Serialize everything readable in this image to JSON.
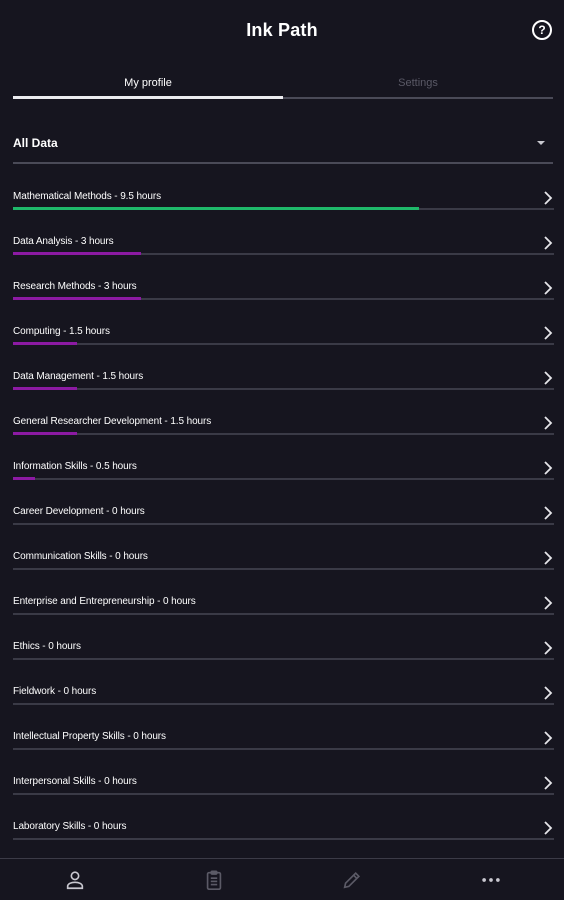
{
  "header": {
    "title": "Ink Path",
    "help_icon": "help-circle-icon"
  },
  "tabs": [
    {
      "label": "My profile",
      "active": true
    },
    {
      "label": "Settings",
      "active": false
    }
  ],
  "filter": {
    "value": "All Data"
  },
  "colors": {
    "background": "#16151f",
    "top_bar": "#1fb86a",
    "bar": "#8c1aa3",
    "track": "#3a3a46"
  },
  "skills": [
    {
      "label": "Mathematical Methods - 9.5 hours",
      "progress": 0.75,
      "color": "#1fb86a"
    },
    {
      "label": "Data Analysis - 3 hours",
      "progress": 0.237,
      "color": "#8c1aa3"
    },
    {
      "label": "Research Methods - 3 hours",
      "progress": 0.237,
      "color": "#8c1aa3"
    },
    {
      "label": "Computing - 1.5 hours",
      "progress": 0.118,
      "color": "#8c1aa3"
    },
    {
      "label": "Data Management - 1.5 hours",
      "progress": 0.118,
      "color": "#8c1aa3"
    },
    {
      "label": "General Researcher Development - 1.5 hours",
      "progress": 0.118,
      "color": "#8c1aa3"
    },
    {
      "label": "Information Skills - 0.5 hours",
      "progress": 0.04,
      "color": "#8c1aa3"
    },
    {
      "label": "Career Development - 0 hours",
      "progress": 0,
      "color": "#8c1aa3"
    },
    {
      "label": "Communication Skills - 0 hours",
      "progress": 0,
      "color": "#8c1aa3"
    },
    {
      "label": "Enterprise and Entrepreneurship - 0 hours",
      "progress": 0,
      "color": "#8c1aa3"
    },
    {
      "label": "Ethics - 0 hours",
      "progress": 0,
      "color": "#8c1aa3"
    },
    {
      "label": "Fieldwork - 0 hours",
      "progress": 0,
      "color": "#8c1aa3"
    },
    {
      "label": "Intellectual Property Skills - 0 hours",
      "progress": 0,
      "color": "#8c1aa3"
    },
    {
      "label": "Interpersonal Skills - 0 hours",
      "progress": 0,
      "color": "#8c1aa3"
    },
    {
      "label": "Laboratory Skills - 0 hours",
      "progress": 0,
      "color": "#8c1aa3"
    }
  ],
  "bottom_nav": [
    {
      "icon": "person-icon"
    },
    {
      "icon": "clipboard-icon"
    },
    {
      "icon": "pencil-icon"
    },
    {
      "icon": "more-icon"
    }
  ]
}
